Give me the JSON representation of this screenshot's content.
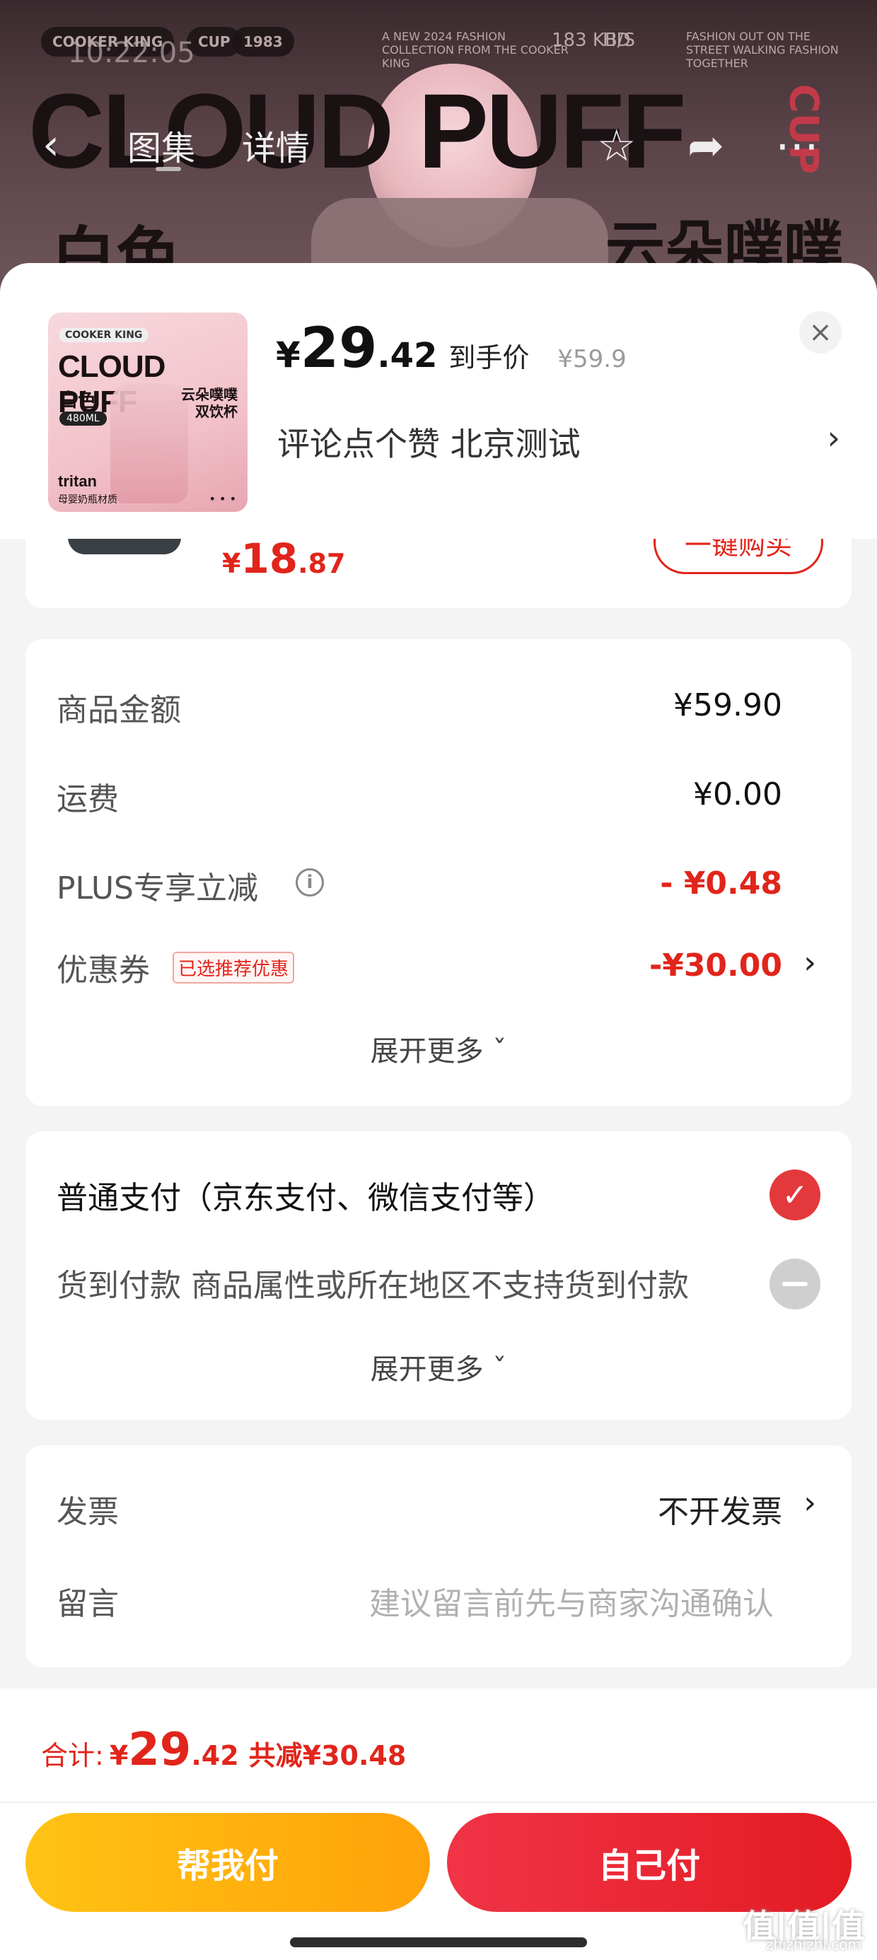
{
  "banner": {
    "brand_chip": "COOKER KING",
    "cup_chip": "CUP",
    "year_chip": "1983",
    "time": "10:22:05",
    "tagline": "A NEW 2024 FASHION COLLECTION FROM THE COOKER KING",
    "net_speed": "183 KB/S",
    "hd": "HD",
    "tagline_right": "FASHION OUT ON THE STREET WALKING FASHION TOGETHER",
    "big_title": "CLOUD PUFF",
    "cup_vertical": "CUP",
    "cn_left": "白色",
    "cn_right": "云朵噗噗"
  },
  "nav": {
    "back_icon": "chevron-left-icon",
    "tab_gallery": "图集",
    "tab_detail": "详情",
    "favorite_icon": "star-icon",
    "share_icon": "share-icon",
    "more_icon": "more-icon"
  },
  "product": {
    "thumb": {
      "chip": "COOKER KING",
      "title": "CLOUD PUFF",
      "color": "白色",
      "name": "云朵噗噗 双饮杯",
      "capacity": "480ML",
      "material": "tritan",
      "material_cn": "母婴奶瓶材质",
      "dots": "• • •"
    },
    "price_symbol": "¥",
    "price_int": "29",
    "price_dec": ".42",
    "price_suffix": "到手价",
    "original_price": "¥59.9",
    "spec": "评论点个赞  北京测试",
    "spec_arrow": "›",
    "close": "×"
  },
  "peek": {
    "price_symbol": "¥",
    "price_int": "18",
    "price_dec": ".87",
    "button": "一键购买"
  },
  "amount": {
    "rows": [
      {
        "label": "商品金额",
        "value": "¥59.90"
      },
      {
        "label": "运费",
        "value": "¥0.00"
      },
      {
        "label": "PLUS专享立减",
        "value": "- ¥0.48"
      },
      {
        "label": "优惠券",
        "tag": "已选推荐优惠",
        "value": "-¥30.00"
      }
    ],
    "info": "i",
    "more": "展开更多 ˇ",
    "chevron": "›"
  },
  "payment": {
    "normal": "普通支付（京东支付、微信支付等）",
    "cod": "货到付款  商品属性或所在地区不支持货到付款",
    "more": "展开更多 ˇ",
    "check": "✓"
  },
  "invoice": {
    "label": "发票",
    "value": "不开发票",
    "chevron": "›",
    "message_label": "留言",
    "message_placeholder": "建议留言前先与商家沟通确认"
  },
  "bottom": {
    "total_label": "合计:",
    "total_symbol": "¥",
    "total_int": "29",
    "total_dec": ".42",
    "saved": "共减¥30.48",
    "help_pay": "帮我付",
    "self_pay": "自己付"
  },
  "watermark": {
    "main": "值|值|值",
    "sub": "zhizhizhi.com"
  },
  "colors": {
    "accent_red": "#e1251b",
    "help_yellow": "#ffb20f",
    "pay_red": "#ed2a36"
  }
}
